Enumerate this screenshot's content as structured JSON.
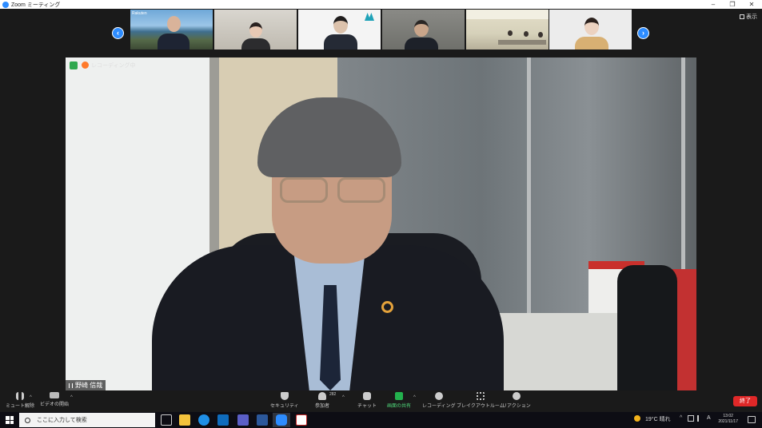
{
  "window": {
    "title": "Zoom ミーティング",
    "minimize": "–",
    "restore": "❐",
    "close": "✕"
  },
  "gallery": {
    "view_label": "表示",
    "prev_arrow": "‹",
    "next_arrow": "›",
    "thumbnail_label": "Rakuten"
  },
  "main_video": {
    "recording_label": "レコーディング中",
    "speaker_name": "野崎 信哉"
  },
  "toolbar": {
    "mute_label": "ミュート解除",
    "video_label": "ビデオの開始",
    "security_label": "セキュリティ",
    "participants_label": "参加者",
    "participants_count": "282",
    "chat_label": "チャット",
    "share_label": "画面の共有",
    "record_label": "レコーディング",
    "breakout_label": "ブレイクアウトルーム",
    "reactions_label": "リアクション",
    "end_label": "終了"
  },
  "taskbar": {
    "search_placeholder": "ここに入力して検索",
    "weather": "19°C 晴れ",
    "ime": "A",
    "time": "13:02",
    "date": "2021/11/17"
  },
  "colors": {
    "zoom_blue": "#2d8cff",
    "end_red": "#e02828",
    "share_green": "#23b14d"
  }
}
